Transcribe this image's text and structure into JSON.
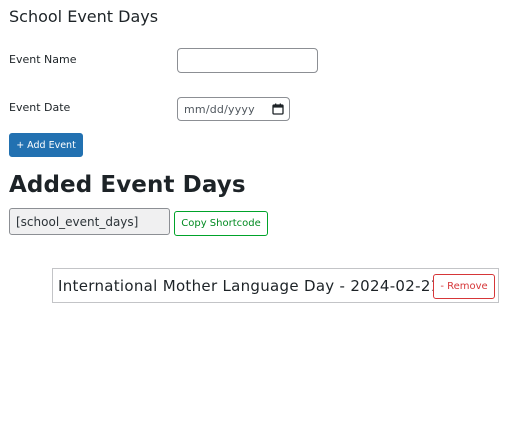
{
  "page": {
    "title": "School Event Days"
  },
  "form": {
    "event_name_label": "Event Name",
    "event_name_value": "",
    "event_date_label": "Event Date",
    "event_date_placeholder": "mm/dd/yyyy",
    "add_button_label": "+ Add Event"
  },
  "added_section": {
    "heading": "Added Event Days",
    "shortcode": "[school_event_days]",
    "copy_button_label": "Copy Shortcode"
  },
  "events": [
    {
      "text": "International Mother Language Day - 2024-02-21",
      "remove_label": "- Remove"
    }
  ],
  "icons": {
    "date_picker": "calendar-icon"
  },
  "colors": {
    "primary_button": "#2271b1",
    "copy_button": "#00a32a",
    "remove_button": "#d63638"
  }
}
